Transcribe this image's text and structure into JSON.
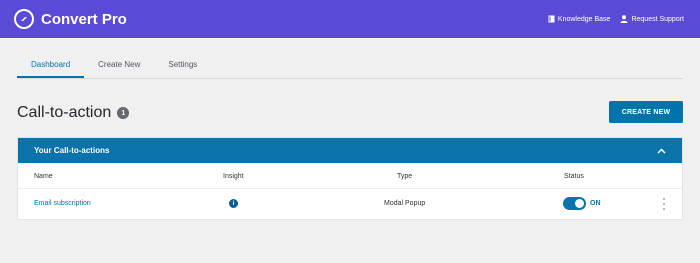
{
  "header": {
    "brand": "Convert Pro",
    "links": [
      {
        "label": "Knowledge Base",
        "icon": "book-icon"
      },
      {
        "label": "Request Support",
        "icon": "person-icon"
      }
    ],
    "colors": {
      "bar": "#5a4bd6"
    }
  },
  "tabs": [
    {
      "label": "Dashboard",
      "active": true
    },
    {
      "label": "Create New",
      "active": false
    },
    {
      "label": "Settings",
      "active": false
    }
  ],
  "page": {
    "title": "Call-to-action",
    "count": "1",
    "create_button": "CREATE NEW"
  },
  "panel": {
    "title": "Your Call-to-actions",
    "columns": {
      "name": "Name",
      "insight": "Insight",
      "type": "Type",
      "status": "Status"
    },
    "rows": [
      {
        "name": "Email subscription",
        "insight_icon": "info-icon",
        "type": "Modal Popup",
        "status": "ON",
        "enabled": true
      }
    ],
    "accent": "#0a73ab"
  }
}
